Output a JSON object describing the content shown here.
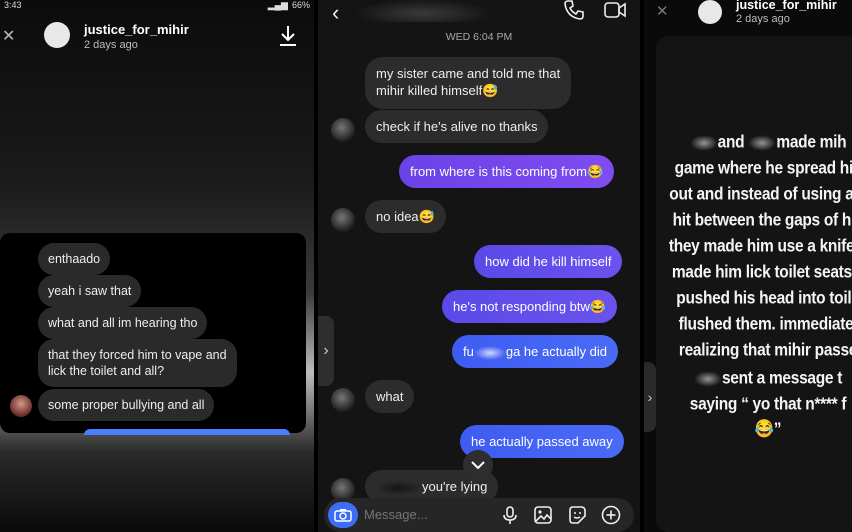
{
  "left": {
    "status_time": "3:43",
    "status_battery": "66%",
    "username": "justice_for_mihir",
    "posted": "2 days ago",
    "messages": [
      "enthaado",
      "yeah i saw that",
      "what and all im hearing tho",
      "that they forced him to vape and",
      "lick the toilet and all?",
      "some proper bullying and all"
    ]
  },
  "middle": {
    "timestamp": "WED 6:04 PM",
    "msg1_line1": "my sister came and told me that",
    "msg1_line2": "mihir killed himself",
    "msg2": "check if he's alive no thanks",
    "msg3": "from where is this coming from",
    "msg4": "no idea",
    "msg5": "how did he kill himself",
    "msg6": "he's not responding btw",
    "msg7_prefix": "fu",
    "msg7_suffix": "ga he actually did",
    "msg8": "what",
    "msg9": "he actually passed away",
    "msg10": "you're lying",
    "composer_placeholder": "Message...",
    "emoji_laugh": "😂",
    "emoji_smile": "😅"
  },
  "right": {
    "username": "justice_for_mihir",
    "posted": "2 days ago",
    "story_lines": [
      "and",
      "made mih",
      "game where he spread his",
      "out and instead of using a p",
      "hit between the gaps of his",
      "they made him use a knife. t",
      "made him lick toilet seats a",
      "pushed his head into toile",
      "flushed them. immediatel",
      "realizing that mihir passe",
      "sent a message t",
      "saying “ yo that n**** f",
      "😂”"
    ]
  }
}
